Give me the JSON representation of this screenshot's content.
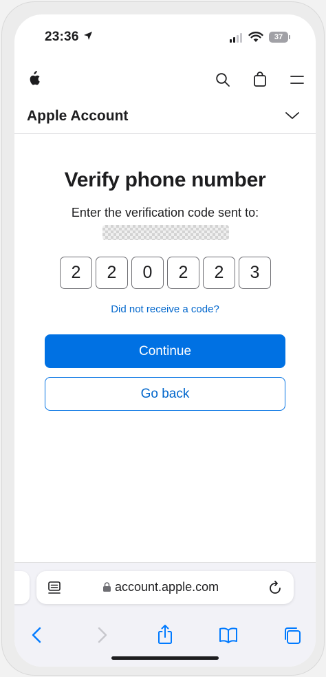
{
  "status_bar": {
    "time": "23:36",
    "battery": "37"
  },
  "site_nav": {
    "section_title": "Apple Account"
  },
  "content": {
    "title": "Verify phone number",
    "description": "Enter the verification code sent to:",
    "code_digits": [
      "2",
      "2",
      "0",
      "2",
      "2",
      "3"
    ],
    "resend_link": "Did not receive a code?",
    "continue_label": "Continue",
    "go_back_label": "Go back"
  },
  "browser": {
    "url": "account.apple.com"
  },
  "colors": {
    "accent": "#0071e3",
    "link": "#0066cc",
    "safari_icon": "#007aff"
  },
  "icons": {
    "status": [
      "location-arrow-icon",
      "cellular-signal-icon",
      "wifi-icon",
      "battery-icon"
    ],
    "nav": [
      "apple-logo-icon",
      "search-icon",
      "bag-icon",
      "menu-icon",
      "chevron-down-icon"
    ],
    "url_bar": [
      "reader-icon",
      "lock-icon",
      "reload-icon"
    ],
    "toolbar": [
      "back-icon",
      "forward-icon",
      "share-icon",
      "bookmarks-icon",
      "tabs-icon"
    ]
  }
}
